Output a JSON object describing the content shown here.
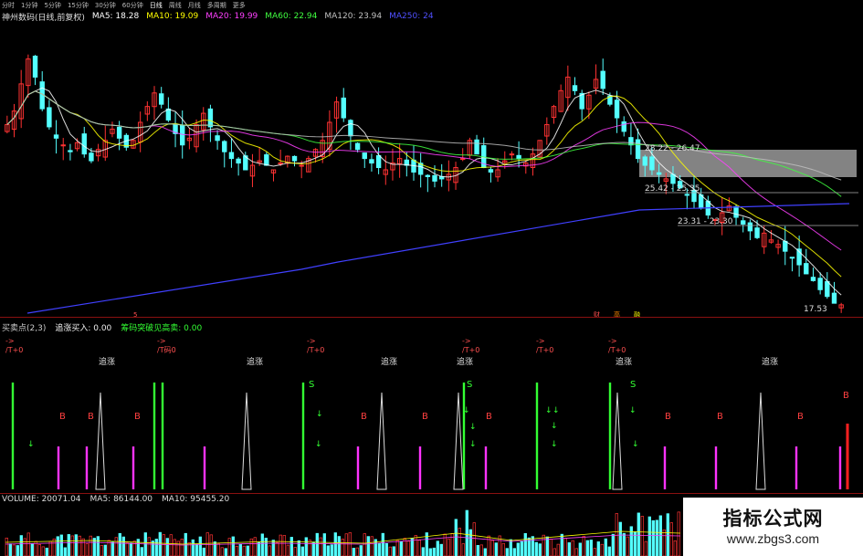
{
  "toolbar": {
    "items": [
      "分时",
      "1分钟",
      "5分钟",
      "15分钟",
      "30分钟",
      "60分钟",
      "日线",
      "周线",
      "月线",
      "多周期",
      "更多"
    ]
  },
  "main_header": {
    "title": "神州数码(日线,前复权)",
    "ma5": "MA5: 18.28",
    "ma10": "MA10: 19.09",
    "ma20": "MA20: 19.99",
    "ma60": "MA60: 22.94",
    "ma120": "MA120: 23.94",
    "ma250": "MA250: 24"
  },
  "price_labels": {
    "box1": "28.22 - 26.47",
    "box2": "25.42 - 25.35",
    "box3": "23.31 - 23.30",
    "last": "17.53",
    "tags": [
      "财",
      "高",
      "融"
    ],
    "marker": "5"
  },
  "indicator_header": {
    "name": "买卖点(2,3)",
    "buy": "追涨买入: 0.00",
    "sell": "筹码突破见高卖: 0.00"
  },
  "signals": {
    "zhuizhang": "追涨",
    "tplus": "/T+0",
    "tplus2": "/T码0",
    "s": "S",
    "b": "B"
  },
  "volume_header": {
    "volume": "VOLUME: 20071.04",
    "ma5": "MA5: 86144.00",
    "ma10": "MA10: 95455.20"
  },
  "watermark": {
    "title": "指标公式网",
    "url": "www.zbgs3.com"
  },
  "colors": {
    "up": "#ff3232",
    "down": "#54ffff",
    "ma5": "#ffffff",
    "ma10": "#ffff00",
    "ma20": "#ff40ff",
    "ma60": "#40ff40",
    "ma120": "#c0c0c0",
    "ma250": "#4040ff",
    "green_signal": "#33ff33",
    "magenta_signal": "#ff33ff"
  },
  "chart_data": {
    "type": "candlestick",
    "y_range": [
      17.0,
      30.0
    ],
    "closes": [
      25.5,
      26.1,
      27.3,
      28.4,
      27.6,
      26.2,
      25.4,
      24.9,
      24.6,
      24.3,
      24.7,
      24.2,
      23.9,
      24.4,
      24.8,
      25.3,
      24.9,
      24.5,
      24.8,
      25.6,
      26.3,
      26.9,
      26.4,
      25.7,
      25.1,
      24.6,
      24.9,
      25.5,
      26.0,
      25.4,
      24.8,
      24.3,
      24.0,
      23.8,
      23.5,
      23.7,
      23.9,
      23.7,
      23.5,
      23.8,
      24.1,
      23.9,
      23.7,
      24.0,
      24.4,
      24.8,
      25.6,
      26.5,
      25.8,
      25.0,
      24.4,
      24.0,
      23.8,
      23.6,
      23.5,
      23.8,
      24.0,
      23.7,
      23.4,
      23.3,
      23.2,
      23.0,
      23.1,
      23.3,
      23.6,
      24.0,
      24.8,
      24.2,
      23.6,
      23.4,
      23.5,
      23.9,
      24.2,
      24.0,
      23.8,
      24.2,
      24.8,
      25.5,
      26.3,
      27.0,
      27.6,
      27.0,
      26.2,
      26.8,
      27.5,
      27.1,
      26.4,
      25.8,
      25.2,
      24.6,
      24.0,
      23.7,
      23.5,
      23.3,
      23.1,
      22.9,
      22.7,
      22.4,
      22.1,
      21.8,
      21.5,
      21.3,
      21.6,
      21.9,
      21.4,
      21.1,
      20.8,
      20.5,
      20.7,
      20.4,
      20.2,
      19.9,
      19.6,
      19.3,
      18.9,
      18.6,
      18.2,
      17.9,
      17.6,
      17.53
    ]
  }
}
